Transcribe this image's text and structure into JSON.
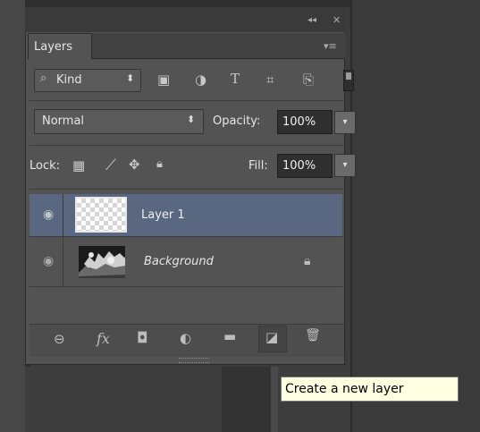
{
  "window": {
    "collapse_glyph": "◂◂",
    "close_glyph": "✕"
  },
  "panel": {
    "tab_label": "Layers",
    "menu_glyph": "▾≡"
  },
  "filter": {
    "search_glyph": "⌕",
    "label": "Kind",
    "arrow": "⬍",
    "icons": [
      {
        "name": "pixel-layer-filter-icon",
        "glyph": "▣"
      },
      {
        "name": "adjustment-layer-filter-icon",
        "glyph": "◑"
      },
      {
        "name": "type-layer-filter-icon",
        "glyph": "T"
      },
      {
        "name": "shape-layer-filter-icon",
        "glyph": "⌗"
      },
      {
        "name": "smart-object-filter-icon",
        "glyph": "⎘"
      }
    ]
  },
  "blend": {
    "mode": "Normal",
    "arrow": "⬍",
    "opacity_label": "Opacity:",
    "opacity_value": "100%",
    "dropdown_glyph": "▾"
  },
  "lock": {
    "label": "Lock:",
    "fill_label": "Fill:",
    "fill_value": "100%",
    "dropdown_glyph": "▾",
    "icons": [
      {
        "name": "lock-transparent-pixels-icon",
        "glyph": "▦"
      },
      {
        "name": "lock-image-pixels-icon",
        "glyph": "⟋"
      },
      {
        "name": "lock-position-icon",
        "glyph": "✥"
      },
      {
        "name": "lock-all-icon",
        "glyph": "🔒︎"
      }
    ]
  },
  "layers": [
    {
      "name": "Layer 1",
      "selected": true,
      "visible_glyph": "◉"
    },
    {
      "name": "Background",
      "selected": false,
      "visible_glyph": "◉",
      "lock_glyph": "🔒︎"
    }
  ],
  "toolbar": [
    {
      "name": "link-layers-icon",
      "glyph": "⊖"
    },
    {
      "name": "layer-style-icon",
      "glyph": "fx"
    },
    {
      "name": "layer-mask-icon",
      "glyph": "◘"
    },
    {
      "name": "adjustment-layer-icon",
      "glyph": "◐"
    },
    {
      "name": "new-group-icon",
      "glyph": "▬"
    },
    {
      "name": "new-layer-icon",
      "glyph": "◪"
    },
    {
      "name": "delete-layer-icon",
      "glyph": "🗑︎"
    }
  ],
  "tooltip": {
    "text": "Create a new layer"
  }
}
